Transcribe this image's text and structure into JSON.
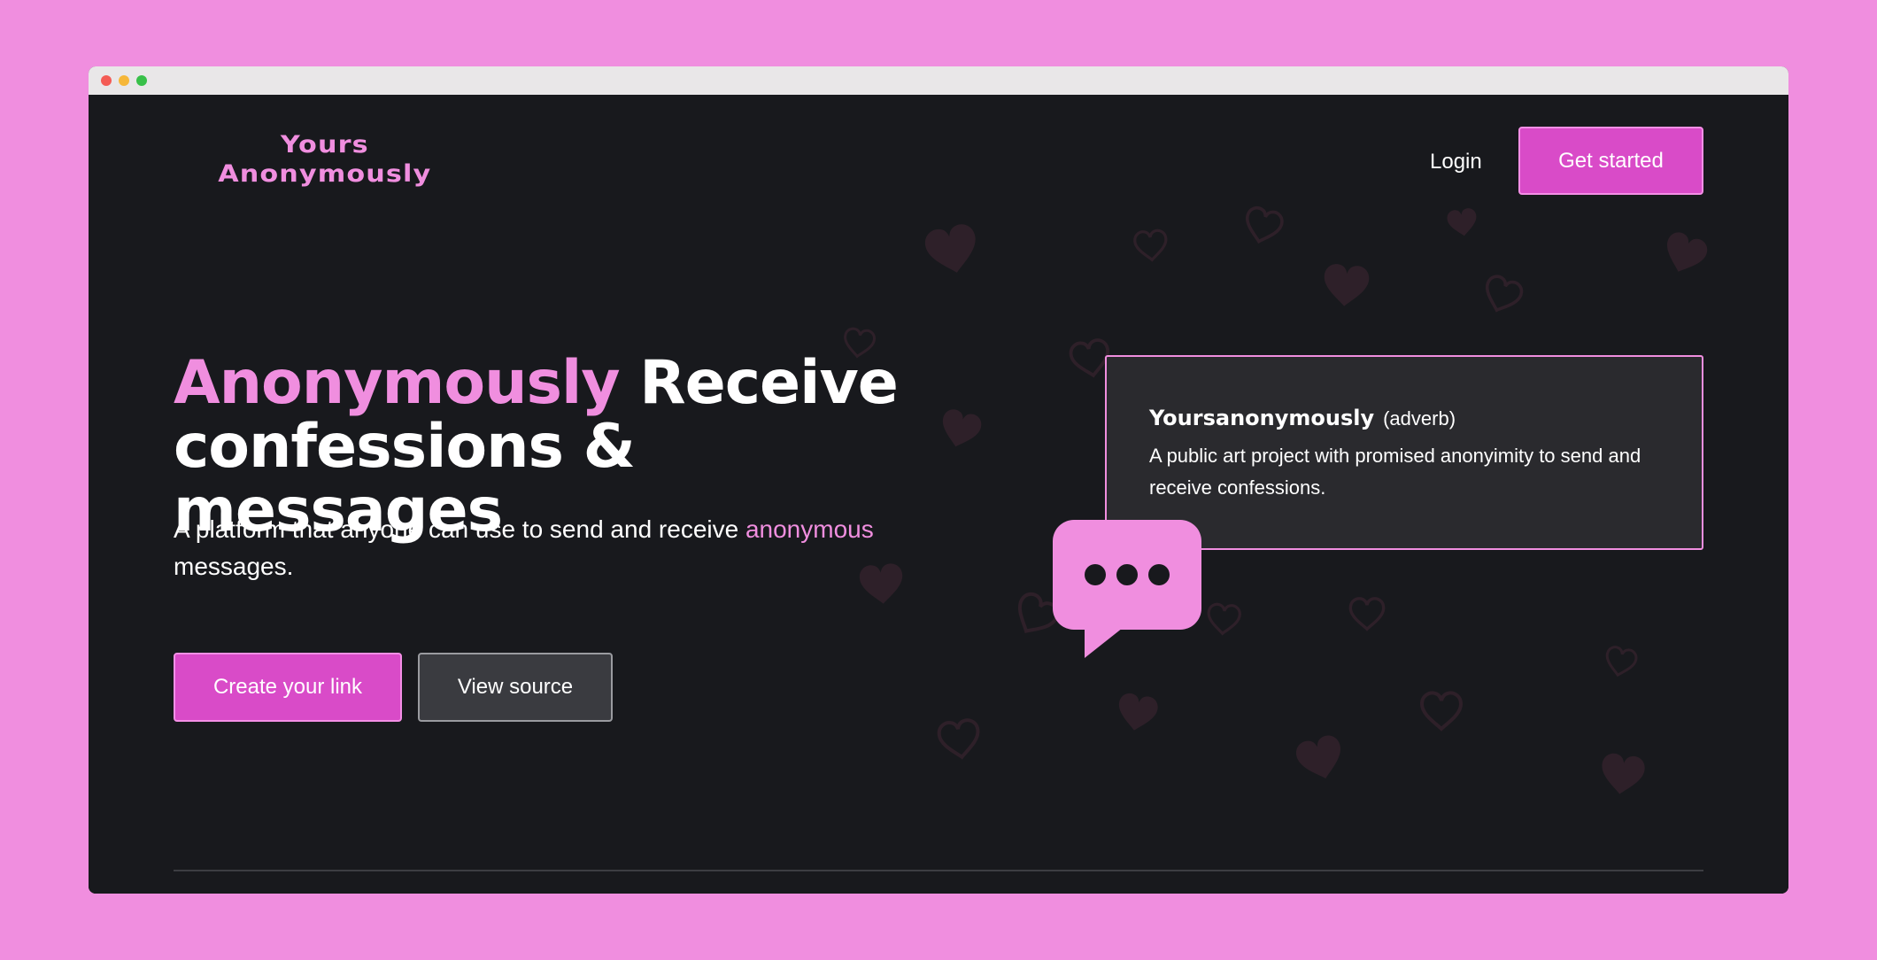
{
  "colors": {
    "page_background": "#f08edf",
    "app_background": "#18191d",
    "accent_pink": "#f08edf",
    "button_magenta": "#d94bc8",
    "card_background": "#2a2a2e",
    "secondary_button": "#3a3b40"
  },
  "browser": {
    "traffic_lights": [
      "close",
      "minimize",
      "maximize"
    ]
  },
  "header": {
    "logo_line1": "Yours",
    "logo_line2": "Anonymously",
    "login_label": "Login",
    "get_started_label": "Get started"
  },
  "hero": {
    "headline_accent": "Anonymously",
    "headline_line1_rest": " Receive",
    "headline_line2": "confessions & messages",
    "subtitle_before": "A platform that anyone can use to send and receive ",
    "subtitle_accent": "anonymous",
    "subtitle_after": " messages.",
    "create_link_label": "Create your link",
    "view_source_label": "View source"
  },
  "definition_card": {
    "word": "Yoursanonymously",
    "part_of_speech": "(adverb)",
    "definition": "A public art project with promised anonyimity to send and receive confessions."
  },
  "icons": {
    "chat_bubble": "chat-bubble-ellipsis-icon",
    "background_pattern": "heart-icon"
  }
}
